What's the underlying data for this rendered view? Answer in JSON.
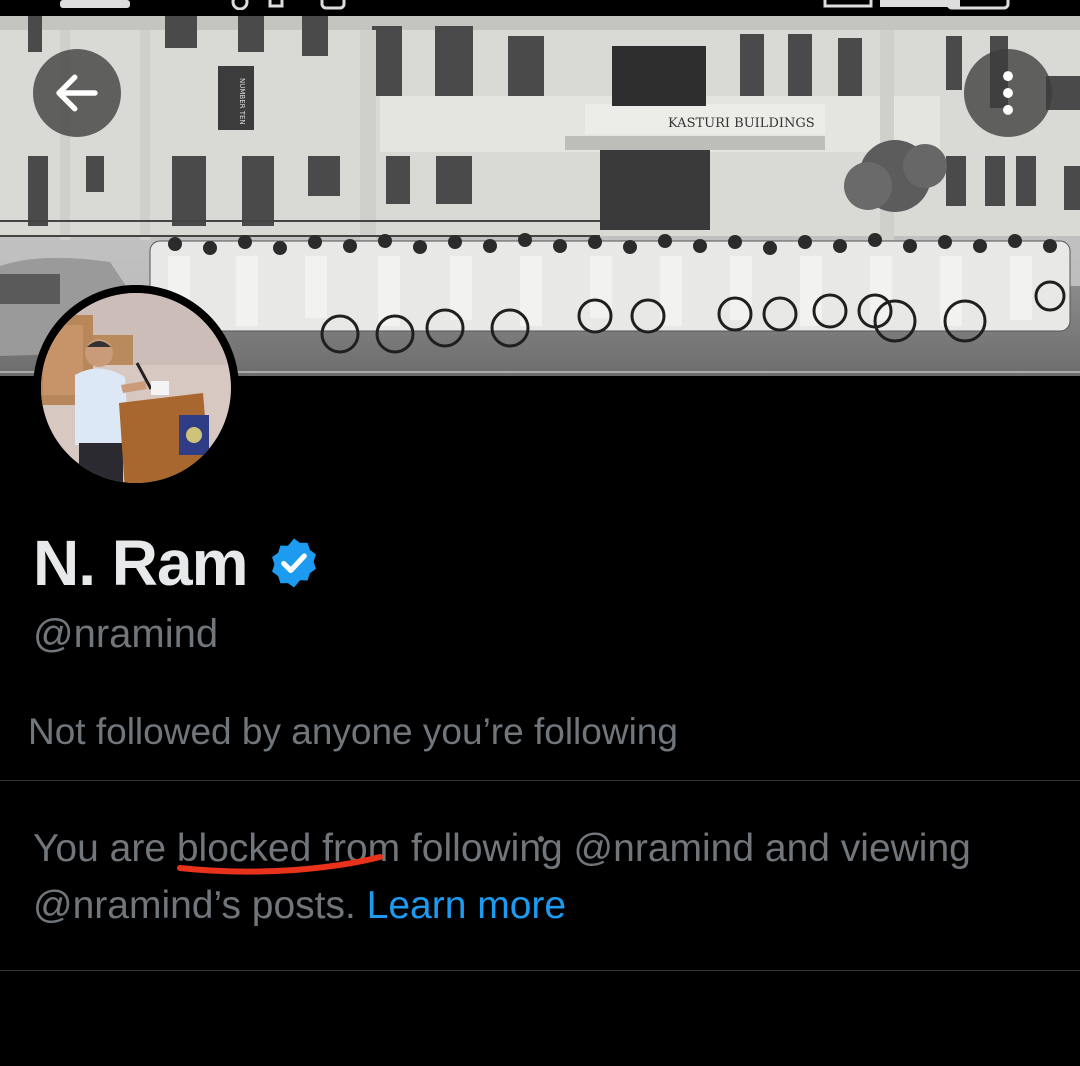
{
  "profile": {
    "display_name": "N. Ram",
    "handle": "@nramind",
    "verified": true,
    "followers_note": "Not followed by anyone you’re following"
  },
  "banner": {
    "sign_text": "KASTURI BUILDINGS",
    "vertical_sign_text": "NUMBER TEN"
  },
  "blocked_notice": {
    "prefix": "You are ",
    "word_blocked": "blocked",
    "middle": " from following @nramind and viewing @nramind’s posts. ",
    "learn_more": "Learn more"
  },
  "header": {
    "back_icon": "arrow-left-icon",
    "more_icon": "more-vertical-icon"
  },
  "colors": {
    "background": "#000000",
    "primary_text": "#e7e9ea",
    "secondary_text": "#71767b",
    "link": "#1d9bf0",
    "verified_badge": "#1d9bf0",
    "annotation_underline": "#e8321c",
    "divider": "#2f3336"
  }
}
